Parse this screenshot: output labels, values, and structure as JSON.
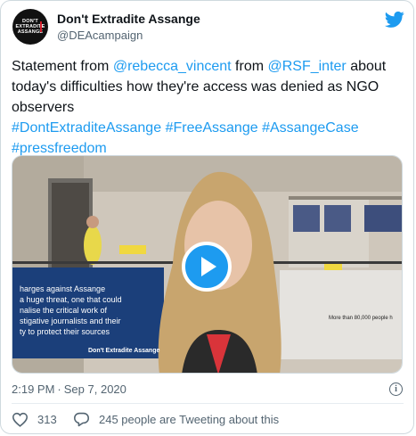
{
  "author": {
    "name": "Don't Extradite Assange",
    "handle": "@DEAcampaign",
    "avatar_text": [
      "DON'T",
      "EXTRADITE",
      "ASSANGE"
    ]
  },
  "icons": {
    "platform": "twitter-bird-icon",
    "play": "play-icon",
    "info": "info-icon",
    "like": "heart-icon",
    "reply": "reply-bubble-icon"
  },
  "colors": {
    "link": "#1d9bf0",
    "text": "#0f1419",
    "muted": "#536471"
  },
  "tweet": {
    "text_1": "Statement from ",
    "mention_1": "@rebecca_vincent",
    "text_2": " from ",
    "mention_2": "@RSF_inter",
    "text_3": " about today's difficulties how they're access was denied as NGO observers",
    "hashtags": [
      "#DontExtraditeAssange",
      "#FreeAssange",
      "#AssangeCase",
      "#pressfreedom"
    ]
  },
  "media": {
    "banner_left": [
      "harges against Assange",
      "a huge threat, one that could",
      "nalise the critical work of",
      "stigative journalists and their",
      "ty to protect their sources"
    ],
    "banner_left_brand": "Don't Extradite Assange",
    "banner_right": "More than 80,000 people h"
  },
  "meta": {
    "time": "2:19 PM",
    "separator": "·",
    "date": "Sep 7, 2020",
    "info_glyph": "i"
  },
  "actions": {
    "likes": "313",
    "info_text": "245 people are Tweeting about this"
  }
}
